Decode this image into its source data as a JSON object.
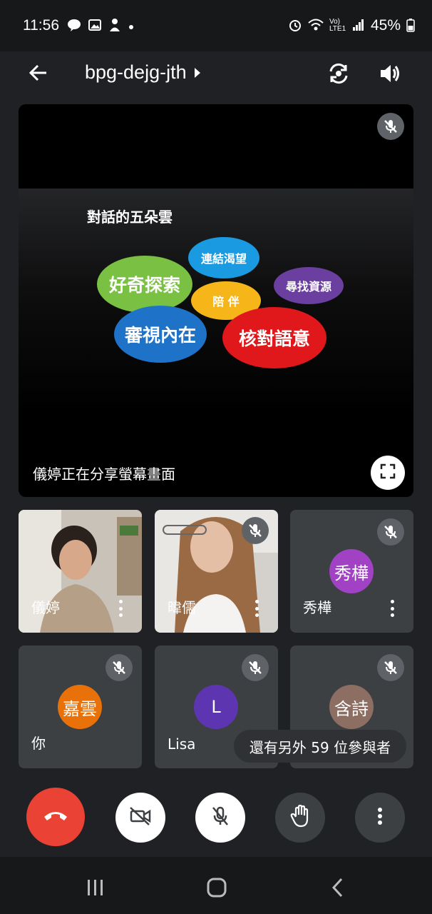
{
  "status_bar": {
    "time": "11:56",
    "network": "Vo) LTE1",
    "battery": "45%"
  },
  "header": {
    "meeting_code": "bpg-dejg-jth"
  },
  "share": {
    "slide_title": "對話的五朵雲",
    "clouds": [
      "好奇探索",
      "連結渴望",
      "尋找資源",
      "陪 伴",
      "審視內在",
      "核對語意"
    ],
    "sharing_label": "儀婷正在分享螢幕畫面"
  },
  "participants": [
    {
      "name": "儀婷",
      "video": true
    },
    {
      "name": "暐儒",
      "video": true,
      "muted": true
    },
    {
      "name": "秀樺",
      "initial": "秀樺",
      "avatar_color": "#a142c4",
      "muted": true
    },
    {
      "name": "你",
      "initial": "嘉雲",
      "avatar_color": "#e8710a",
      "muted": true
    },
    {
      "name": "Lisa",
      "initial": "L",
      "avatar_color": "#5e35b1",
      "muted": true
    },
    {
      "name": "含詩",
      "initial": "含詩",
      "avatar_color": "#8d6e63",
      "muted": true
    }
  ],
  "more_participants": {
    "text": "還有另外 59 位參與者"
  },
  "colors": {
    "end_call": "#ea4335",
    "background": "#202124"
  }
}
